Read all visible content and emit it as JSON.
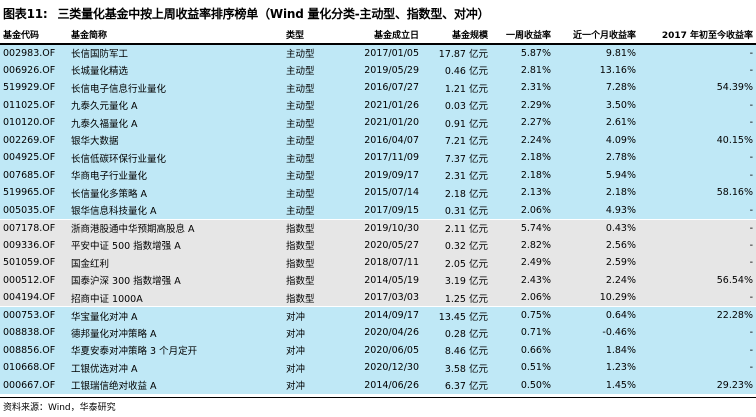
{
  "title": {
    "label": "图表11:",
    "text": "三类量化基金中按上周收益率排序榜单（Wind 量化分类-主动型、指数型、对冲）"
  },
  "headers": [
    "基金代码",
    "基金简称",
    "类型",
    "基金成立日",
    "基金规模",
    "一周收益率",
    "近一个月收益率",
    "2017 年初至今收益率"
  ],
  "groups": [
    {
      "name": "active",
      "rows": [
        [
          "002983.OF",
          "长信国防军工",
          "主动型",
          "2017/01/05",
          "17.87 亿元",
          "5.87%",
          "9.81%",
          "-"
        ],
        [
          "006926.OF",
          "长城量化精选",
          "主动型",
          "2019/05/29",
          "0.46 亿元",
          "2.81%",
          "13.16%",
          "-"
        ],
        [
          "519929.OF",
          "长信电子信息行业量化",
          "主动型",
          "2016/07/27",
          "1.21 亿元",
          "2.31%",
          "7.28%",
          "54.39%"
        ],
        [
          "011025.OF",
          "九泰久元量化 A",
          "主动型",
          "2021/01/26",
          "0.03 亿元",
          "2.29%",
          "3.50%",
          "-"
        ],
        [
          "010120.OF",
          "九泰久福量化 A",
          "主动型",
          "2021/01/20",
          "0.91 亿元",
          "2.27%",
          "2.61%",
          "-"
        ],
        [
          "002269.OF",
          "银华大数据",
          "主动型",
          "2016/04/07",
          "7.21 亿元",
          "2.24%",
          "4.09%",
          "40.15%"
        ],
        [
          "004925.OF",
          "长信低碳环保行业量化",
          "主动型",
          "2017/11/09",
          "7.37 亿元",
          "2.18%",
          "2.78%",
          "-"
        ],
        [
          "007685.OF",
          "华商电子行业量化",
          "主动型",
          "2019/09/17",
          "2.31 亿元",
          "2.18%",
          "5.94%",
          "-"
        ],
        [
          "519965.OF",
          "长信量化多策略 A",
          "主动型",
          "2015/07/14",
          "2.18 亿元",
          "2.13%",
          "2.18%",
          "58.16%"
        ],
        [
          "005035.OF",
          "银华信息科技量化 A",
          "主动型",
          "2017/09/15",
          "0.31 亿元",
          "2.06%",
          "4.93%",
          "-"
        ]
      ]
    },
    {
      "name": "index",
      "rows": [
        [
          "007178.OF",
          "浙商港股通中华预期高股息 A",
          "指数型",
          "2019/10/30",
          "2.11 亿元",
          "5.74%",
          "0.43%",
          "-"
        ],
        [
          "009336.OF",
          "平安中证 500 指数增强 A",
          "指数型",
          "2020/05/27",
          "0.32 亿元",
          "2.82%",
          "2.56%",
          "-"
        ],
        [
          "501059.OF",
          "国金红利",
          "指数型",
          "2018/07/11",
          "2.05 亿元",
          "2.49%",
          "2.59%",
          "-"
        ],
        [
          "000512.OF",
          "国泰沪深 300 指数增强 A",
          "指数型",
          "2014/05/19",
          "3.19 亿元",
          "2.43%",
          "2.24%",
          "56.54%"
        ],
        [
          "004194.OF",
          "招商中证 1000A",
          "指数型",
          "2017/03/03",
          "1.25 亿元",
          "2.06%",
          "10.29%",
          "-"
        ]
      ]
    },
    {
      "name": "hedge",
      "rows": [
        [
          "000753.OF",
          "华宝量化对冲 A",
          "对冲",
          "2014/09/17",
          "13.45 亿元",
          "0.75%",
          "0.64%",
          "22.28%"
        ],
        [
          "008838.OF",
          "德邦量化对冲策略 A",
          "对冲",
          "2020/04/26",
          "0.28 亿元",
          "0.71%",
          "-0.46%",
          "-"
        ],
        [
          "008856.OF",
          "华夏安泰对冲策略 3 个月定开",
          "对冲",
          "2020/06/05",
          "8.46 亿元",
          "0.66%",
          "1.84%",
          "-"
        ],
        [
          "010668.OF",
          "工银优选对冲 A",
          "对冲",
          "2020/12/30",
          "3.58 亿元",
          "0.51%",
          "1.23%",
          "-"
        ],
        [
          "000667.OF",
          "工银瑞信绝对收益 A",
          "对冲",
          "2014/06/26",
          "6.37 亿元",
          "0.50%",
          "1.45%",
          "29.23%"
        ]
      ]
    }
  ],
  "source": "资料来源：Wind，华泰研究",
  "colors": {
    "active_bg": "#bfe8f6",
    "index_bg": "#e6e6e6",
    "hedge_bg": "#bfe8f6"
  }
}
